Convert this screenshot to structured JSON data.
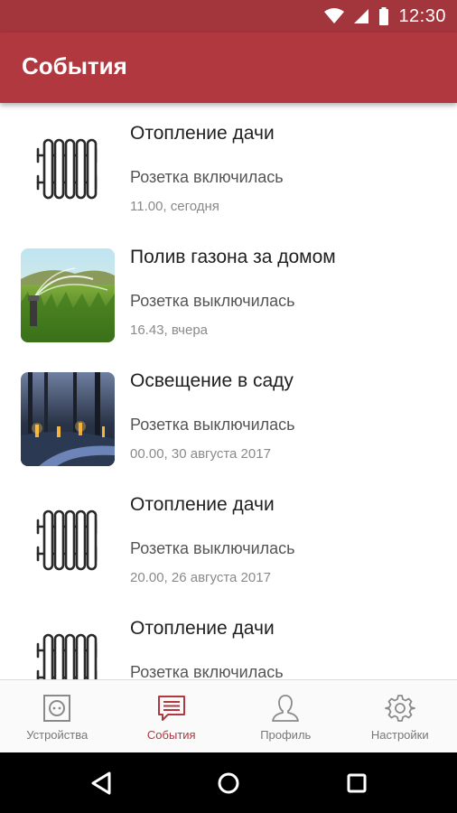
{
  "status_bar": {
    "time": "12:30",
    "icons": [
      "wifi-icon",
      "cellular-signal-icon",
      "battery-icon"
    ]
  },
  "app_bar": {
    "title": "События"
  },
  "events": [
    {
      "title": "Отопление дачи",
      "status": "Розетка включилась",
      "time": "11.00, сегодня",
      "icon": "radiator-icon"
    },
    {
      "title": "Полив газона за домом",
      "status": "Розетка выключилась",
      "time": "16.43, вчера",
      "icon": "lawn-sprinkler-thumbnail"
    },
    {
      "title": "Освещение в саду",
      "status": "Розетка выключилась",
      "time": "00.00, 30 августа 2017",
      "icon": "garden-lights-thumbnail"
    },
    {
      "title": "Отопление дачи",
      "status": "Розетка выключилась",
      "time": "20.00, 26 августа 2017",
      "icon": "radiator-icon"
    },
    {
      "title": "Отопление дачи",
      "status": "Розетка включилась",
      "time": "",
      "icon": "radiator-icon"
    }
  ],
  "bottom_nav": [
    {
      "label": "Устройства",
      "icon": "socket-icon",
      "active": false
    },
    {
      "label": "События",
      "icon": "chat-icon",
      "active": true
    },
    {
      "label": "Профиль",
      "icon": "person-icon",
      "active": false
    },
    {
      "label": "Настройки",
      "icon": "gear-icon",
      "active": false
    }
  ],
  "colors": {
    "primary": "#b1383f",
    "status_bar": "#a3353c",
    "nav_inactive": "#777777"
  }
}
